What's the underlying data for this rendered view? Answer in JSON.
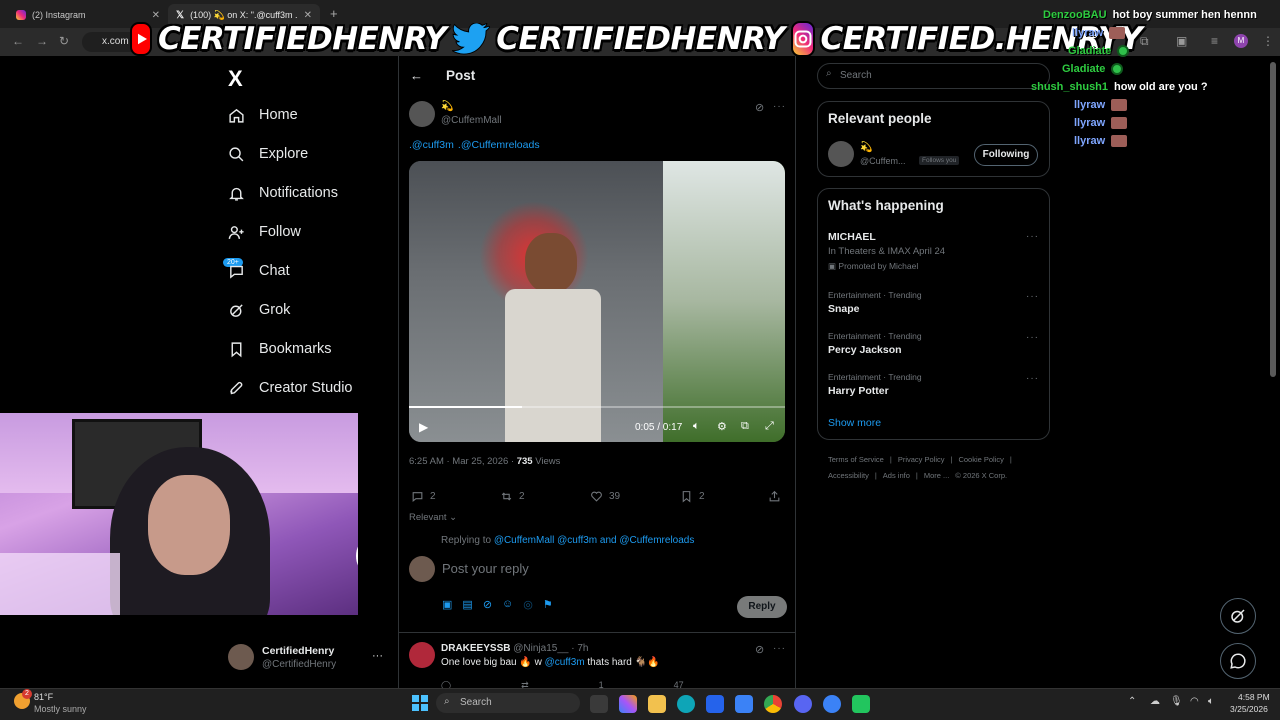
{
  "browser": {
    "tabs": [
      {
        "label": "(2) Instagram",
        "active": false
      },
      {
        "label": "(100) 💫 on X: \".@cuff3m .@Cu",
        "active": true
      }
    ],
    "new_tab": "+",
    "url": "x.com"
  },
  "banner": {
    "youtube": "CERTIFIEDHENRY",
    "twitter": "CERTIFIEDHENRY",
    "instagram": "CERTIFIED.HENRYY"
  },
  "chat": [
    {
      "user": "DenzooBAU",
      "msg": "hot boy summer hen hennn",
      "color": "#2ecc40"
    },
    {
      "user": "llyraw",
      "msg": "",
      "color": "#7fa6ff"
    },
    {
      "user": "Gladiate",
      "msg": "",
      "color": "#2ecc40"
    },
    {
      "user": "Gladiate",
      "msg": "",
      "color": "#2ecc40"
    },
    {
      "user": "shush_shush1",
      "msg": "how old are you ?",
      "color": "#2ecc40"
    },
    {
      "user": "llyraw",
      "msg": "",
      "color": "#7fa6ff"
    },
    {
      "user": "llyraw",
      "msg": "",
      "color": "#7fa6ff"
    },
    {
      "user": "llyraw",
      "msg": "",
      "color": "#7fa6ff"
    }
  ],
  "nav": {
    "logo": "X",
    "items": [
      "Home",
      "Explore",
      "Notifications",
      "Follow",
      "Chat",
      "Grok",
      "Bookmarks",
      "Creator Studio"
    ],
    "chat_badge": "20+",
    "account_name": "CertifiedHenry",
    "account_handle": "@CertifiedHenry"
  },
  "post": {
    "header": "Post",
    "author_name": "💫",
    "author_handle": "@CuffemMall",
    "text_mentions": [
      ".@cuff3m",
      ".@Cuffemreloads"
    ],
    "video_time": "0:05 / 0:17",
    "video_progress": 0.3,
    "timestamp": "6:25 AM · Mar 25, 2026 · ",
    "views_count": "735",
    "views_label": " Views",
    "replies": "2",
    "reposts": "2",
    "likes": "39",
    "bookmarks": "2",
    "sort": "Relevant",
    "replying_prefix": "Replying to ",
    "replying_to": "@CuffemMall @cuff3m and @Cuffemreloads",
    "reply_placeholder": "Post your reply",
    "reply_button": "Reply"
  },
  "reply": {
    "name": "DRAKEEYSSB",
    "handle": "@Ninja15__ · 7h",
    "text_pre": "One love big bau 🔥 w ",
    "mention": "@cuff3m",
    "text_post": " thats hard 🐐🔥",
    "likes": "1",
    "views": "47"
  },
  "right": {
    "search_placeholder": "Search",
    "relevant_title": "Relevant people",
    "person_name": "💫",
    "person_handle": "@Cuffem...",
    "follows_you": "Follows you",
    "following_button": "Following",
    "happening_title": "What's happening",
    "promo_name": "MICHAEL",
    "promo_sub": "In Theaters & IMAX April 24",
    "promo_by": "Promoted by Michael",
    "trends": [
      {
        "cat": "Entertainment · Trending",
        "name": "Snape"
      },
      {
        "cat": "Entertainment · Trending",
        "name": "Percy Jackson"
      },
      {
        "cat": "Entertainment · Trending",
        "name": "Harry Potter"
      }
    ],
    "show_more": "Show more",
    "footer_row1": [
      "Terms of Service",
      "|",
      "Privacy Policy",
      "|",
      "Cookie Policy",
      "|"
    ],
    "footer_row2": [
      "Accessibility",
      "|",
      "Ads info",
      "|",
      "More ...",
      "© 2026 X Corp."
    ]
  },
  "taskbar": {
    "weather_temp": "81°F",
    "weather_desc": "Mostly sunny",
    "search": "Search",
    "time": "4:58 PM",
    "date": "3/25/2026",
    "weather_badge": "2"
  }
}
